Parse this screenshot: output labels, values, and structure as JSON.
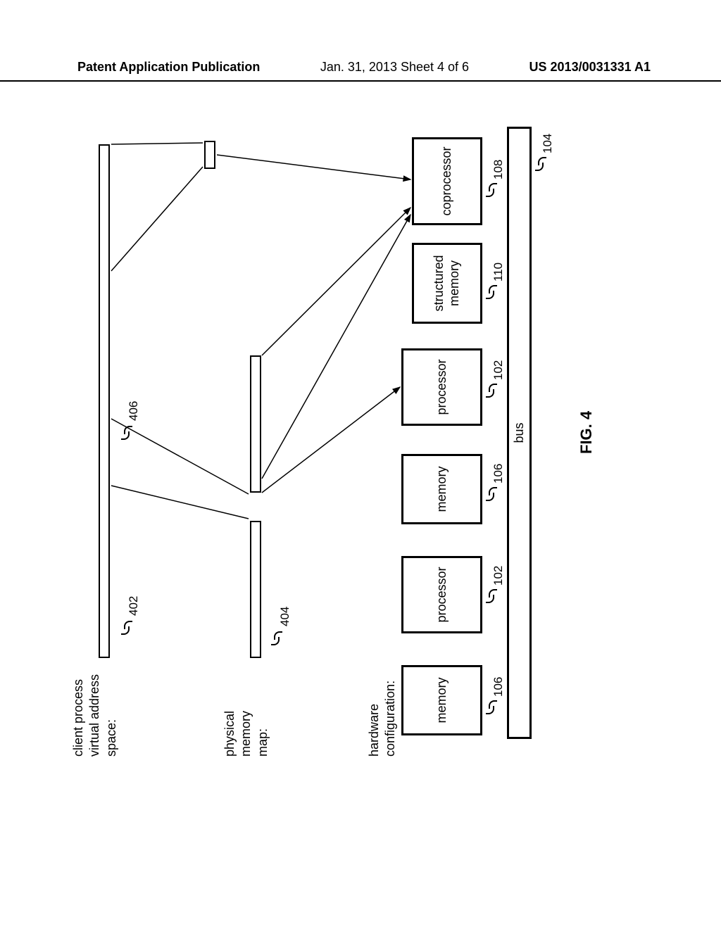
{
  "header": {
    "left": "Patent Application Publication",
    "center": "Jan. 31, 2013  Sheet 4 of 6",
    "right": "US 2013/0031331 A1"
  },
  "labels": {
    "client_process": "client process\nvirtual address\nspace:",
    "physical_memory": "physical\nmemory\nmap:",
    "hardware_config": "hardware\nconfiguration:"
  },
  "boxes": {
    "memory1": "memory",
    "processor1": "processor",
    "memory2": "memory",
    "processor2": "processor",
    "structured_memory": "structured\nmemory",
    "coprocessor": "coprocessor",
    "bus": "bus"
  },
  "refs": {
    "r402": "402",
    "r404": "404",
    "r406": "406",
    "r106a": "106",
    "r102a": "102",
    "r106b": "106",
    "r102b": "102",
    "r110": "110",
    "r108": "108",
    "r104": "104"
  },
  "figure_label": "FIG. 4"
}
